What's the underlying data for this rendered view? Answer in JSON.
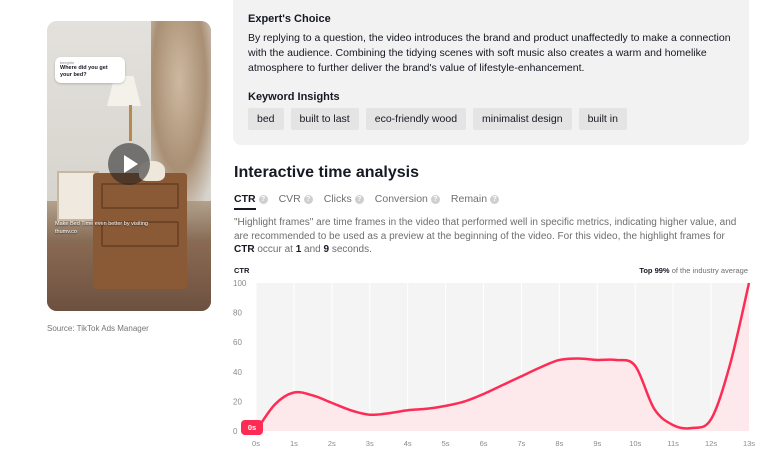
{
  "video": {
    "bubble_small": "beegirls",
    "bubble_question": "Where did you get your bed?",
    "caption": "Make Bed Time even better by visiting thumv.co",
    "source": "Source: TikTok Ads Manager"
  },
  "expert": {
    "title": "Expert's Choice",
    "body": "By replying to a question, the video introduces the brand and product unaffectedly to make a connection with the audience. Combining the tidying scenes with soft music also creates a warm and homelike atmosphere to further deliver the brand's value of lifestyle-enhancement.",
    "keywords_title": "Keyword Insights",
    "keywords": [
      "bed",
      "built to last",
      "eco-friendly wood",
      "minimalist design",
      "built in"
    ]
  },
  "analysis": {
    "title": "Interactive time analysis",
    "tabs": [
      "CTR",
      "CVR",
      "Clicks",
      "Conversion",
      "Remain"
    ],
    "active_tab": "CTR",
    "desc_prefix": "\"Highlight frames\" are time frames in the video that performed well in specific metrics, indicating higher value, and are recommended to be used as a preview at the beginning of the video. For this video, the highlight frames for ",
    "desc_metric": "CTR",
    "desc_middle": " occur at ",
    "desc_f1": "1",
    "desc_and": " and ",
    "desc_f2": "9",
    "desc_suffix": " seconds.",
    "metric_label": "CTR",
    "industry_pct": "Top 99%",
    "industry_text": " of the industry average",
    "marker": "0s"
  },
  "colors": {
    "accent": "#fe2c55",
    "fill": "#fde8ec",
    "grid": "#ffffff",
    "plot_bg": "#f4f4f4"
  },
  "chart_data": {
    "type": "area",
    "x": [
      0,
      0.5,
      1,
      1.5,
      2,
      2.5,
      3,
      3.5,
      4,
      4.5,
      5,
      5.5,
      6,
      6.5,
      7,
      7.5,
      8,
      8.5,
      9,
      9.5,
      10,
      10.5,
      11,
      11.5,
      12,
      12.5,
      13
    ],
    "values": [
      0,
      18,
      26,
      24,
      19,
      14,
      11,
      12,
      14,
      15,
      17,
      20,
      25,
      31,
      37,
      43,
      48,
      49,
      48,
      48,
      44,
      15,
      4,
      2,
      8,
      45,
      100
    ],
    "xticks": [
      "0s",
      "1s",
      "2s",
      "3s",
      "4s",
      "5s",
      "6s",
      "7s",
      "8s",
      "9s",
      "10s",
      "11s",
      "12s",
      "13s"
    ],
    "yticks": [
      "0",
      "20",
      "40",
      "60",
      "80",
      "100"
    ],
    "ylim": [
      0,
      100
    ],
    "xlim": [
      0,
      13
    ],
    "ylabel": "CTR",
    "grid": true
  }
}
